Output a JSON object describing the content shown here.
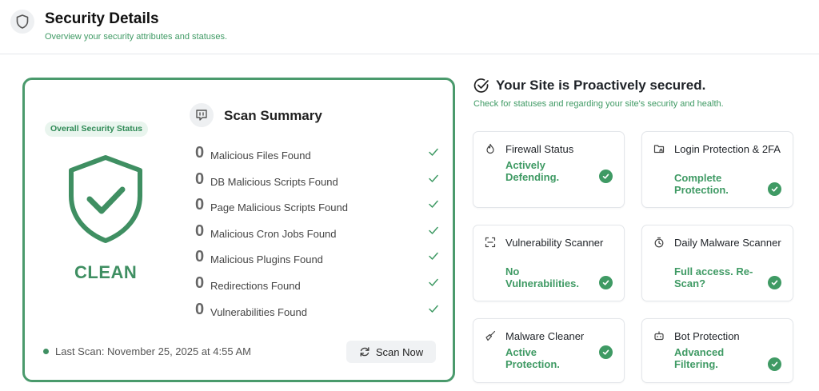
{
  "header": {
    "title": "Security Details",
    "subtitle": "Overview your security attributes and statuses.",
    "icon": "shield-icon"
  },
  "card": {
    "status_label": "Overall Security Status",
    "status_value": "CLEAN",
    "summary_title": "Scan Summary",
    "summary_icon": "message-icon",
    "items": [
      {
        "count": "0",
        "label": "Malicious Files Found"
      },
      {
        "count": "0",
        "label": "DB Malicious Scripts Found"
      },
      {
        "count": "0",
        "label": "Page Malicious Scripts Found"
      },
      {
        "count": "0",
        "label": "Malicious Cron Jobs Found"
      },
      {
        "count": "0",
        "label": "Malicious Plugins Found"
      },
      {
        "count": "0",
        "label": "Redirections Found"
      },
      {
        "count": "0",
        "label": "Vulnerabilities Found"
      }
    ],
    "last_scan": "Last Scan: November 25, 2025 at 4:55 AM",
    "scan_button": "Scan Now"
  },
  "right": {
    "title": "Your Site is Proactively secured.",
    "subtitle": "Check for statuses and regarding your site's security and health.",
    "features": [
      {
        "title": "Firewall Status",
        "status": "Actively Defending.",
        "icon": "flame-icon"
      },
      {
        "title": "Login Protection & 2FA",
        "status": "Complete Protection.",
        "icon": "folder-lock-icon"
      },
      {
        "title": "Vulnerability Scanner",
        "status": "No Vulnerabilities.",
        "icon": "scan-icon"
      },
      {
        "title": "Daily Malware Scanner",
        "status": "Full access. Re-Scan?",
        "icon": "timer-icon"
      },
      {
        "title": "Malware Cleaner",
        "status": "Active Protection.",
        "icon": "brush-icon"
      },
      {
        "title": "Bot Protection",
        "status": "Advanced Filtering.",
        "icon": "bot-icon"
      }
    ]
  },
  "colors": {
    "accent": "#3f9a64",
    "card_border": "#4a9a6c",
    "pill_bg": "#e9f5ee"
  }
}
